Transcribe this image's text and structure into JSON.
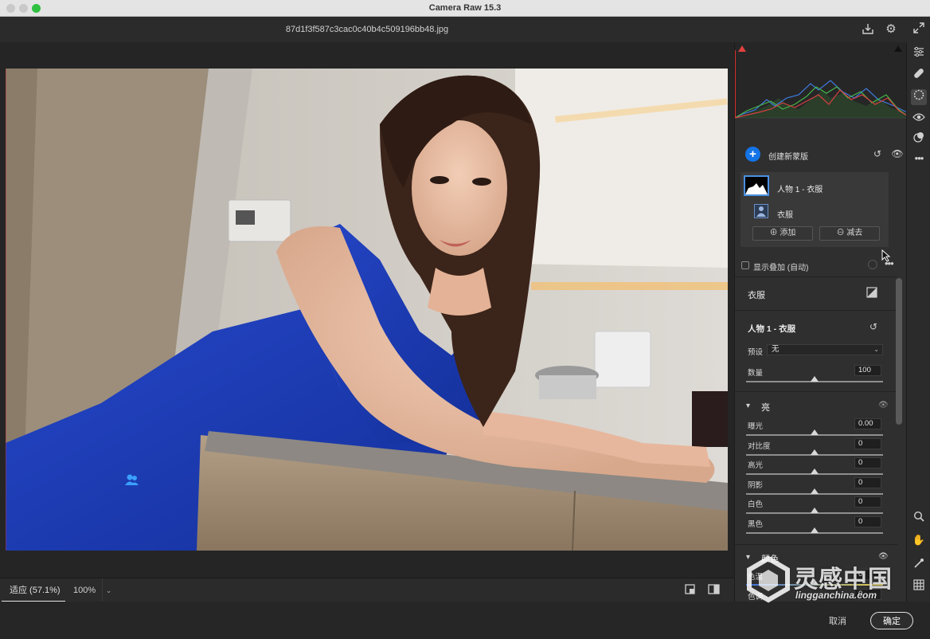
{
  "window": {
    "title": "Camera Raw 15.3"
  },
  "header": {
    "filename": "87d1f3f587c3cac0c40b4c509196bb48.jpg"
  },
  "zoom": {
    "fit_label": "适应 (57.1%)",
    "percent_label": "100%"
  },
  "footer": {
    "cancel_label": "取消",
    "ok_label": "确定"
  },
  "masks": {
    "create_label": "创建新蒙版",
    "mask_name": "人物 1 - 衣服",
    "component_name": "衣服",
    "add_label": "添加",
    "subtract_label": "减去",
    "overlay_label": "显示叠加 (自动)"
  },
  "adjust": {
    "section_title": "衣服",
    "mask_title": "人物 1 - 衣服",
    "preset_label": "预设",
    "preset_value": "无",
    "amount_label": "数量",
    "amount_value": "100",
    "light_group": "亮",
    "sliders": [
      {
        "label": "曝光",
        "value": "0.00"
      },
      {
        "label": "对比度",
        "value": "0"
      },
      {
        "label": "高光",
        "value": "0"
      },
      {
        "label": "阴影",
        "value": "0"
      },
      {
        "label": "白色",
        "value": "0"
      },
      {
        "label": "黑色",
        "value": "0"
      }
    ],
    "color_group": "颜色",
    "color_rows": [
      {
        "label": "色温",
        "value": "0"
      },
      {
        "label": "色调",
        "value": "0"
      }
    ]
  },
  "watermark": {
    "cn": "灵感中国",
    "en": "lingganchina.com"
  },
  "colors": {
    "accent": "#1473e6",
    "panel": "#2f2f2f",
    "dress": "#1a3bb5"
  },
  "icons": {
    "tools": [
      "sliders-icon",
      "healing-icon",
      "mask-icon",
      "redeye-icon",
      "presets-icon",
      "more-icon",
      "zoom-icon",
      "hand-icon",
      "eyedropper-icon",
      "grid-icon"
    ]
  }
}
